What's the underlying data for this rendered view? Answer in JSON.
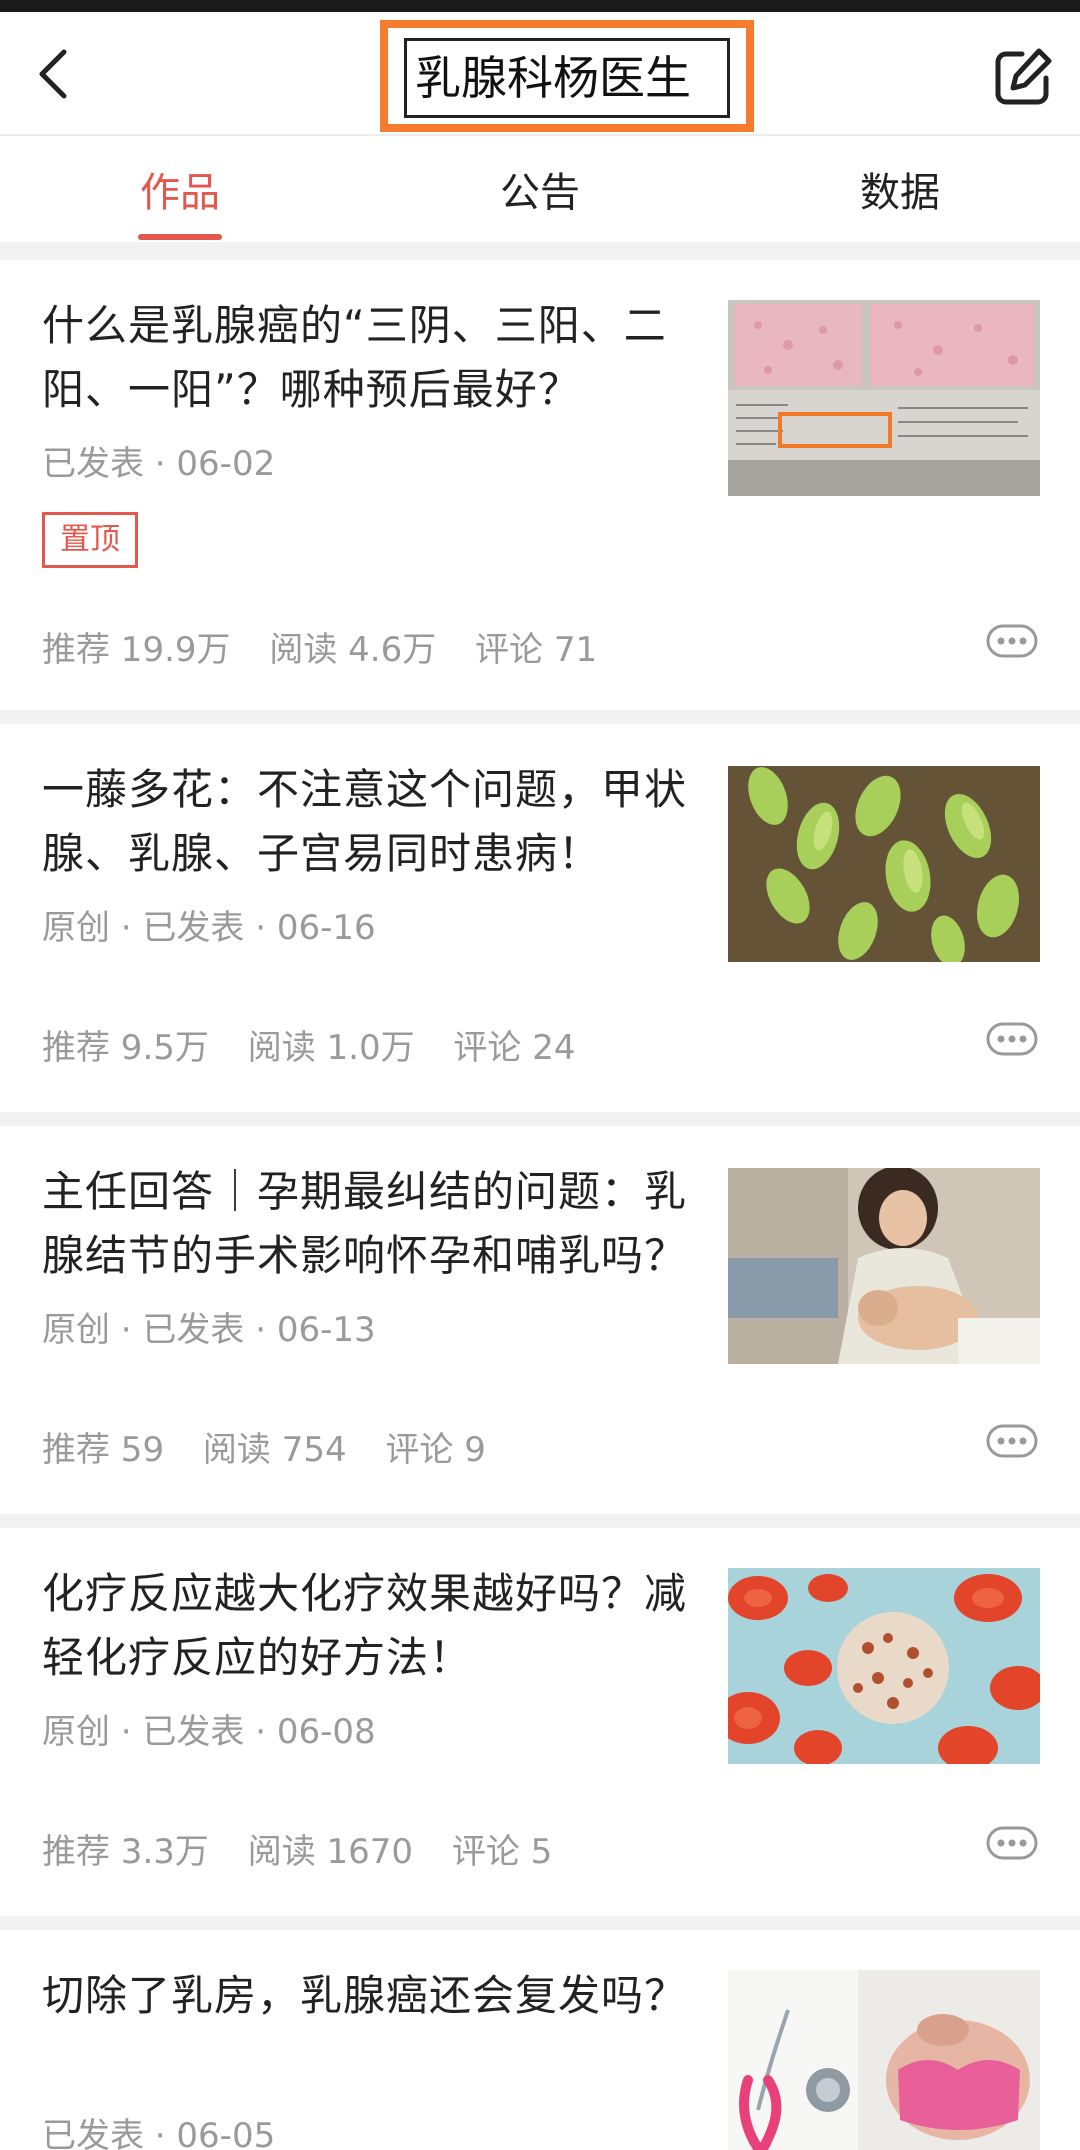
{
  "header": {
    "title": "乳腺科杨医生",
    "back_icon": "chevron-left-icon",
    "edit_icon": "edit-icon"
  },
  "tabs": [
    {
      "label": "作品",
      "active": true
    },
    {
      "label": "公告",
      "active": false
    },
    {
      "label": "数据",
      "active": false
    }
  ],
  "colors": {
    "accent": "#e4574c",
    "highlight_box": "#f77b2c",
    "muted_text": "#9a9a9a",
    "separator": "#f2f2f2"
  },
  "articles": [
    {
      "title": "什么是乳腺癌的“三阴、三阳、二阳、一阳”？哪种预后最好？",
      "meta": "已发表 · 06-02",
      "pinned_label": "置顶",
      "stats": {
        "recommend": "推荐 19.9万",
        "read": "阅读 4.6万",
        "comment": "评论 71"
      },
      "thumb_icon": "pathology-slide-image"
    },
    {
      "title": "一藤多花：不注意这个问题，甲状腺、乳腺、子宫易同时患病！",
      "meta": "原创 · 已发表 · 06-16",
      "stats": {
        "recommend": "推荐 9.5万",
        "read": "阅读 1.0万",
        "comment": "评论 24"
      },
      "thumb_icon": "green-flower-image"
    },
    {
      "title": "主任回答｜孕期最纠结的问题：乳腺结节的手术影响怀孕和哺乳吗？",
      "meta": "原创 · 已发表 · 06-13",
      "stats": {
        "recommend": "推荐 59",
        "read": "阅读 754",
        "comment": "评论 9"
      },
      "thumb_icon": "mother-baby-image"
    },
    {
      "title": "化疗反应越大化疗效果越好吗？减轻化疗反应的好方法！",
      "meta": "原创 · 已发表 · 06-08",
      "stats": {
        "recommend": "推荐 3.3万",
        "read": "阅读 1670",
        "comment": "评论 5"
      },
      "thumb_icon": "blood-cells-image"
    },
    {
      "title": "切除了乳房，乳腺癌还会复发吗？",
      "meta": "已发表 · 06-05",
      "thumb_icon": "pink-ribbon-image"
    }
  ]
}
